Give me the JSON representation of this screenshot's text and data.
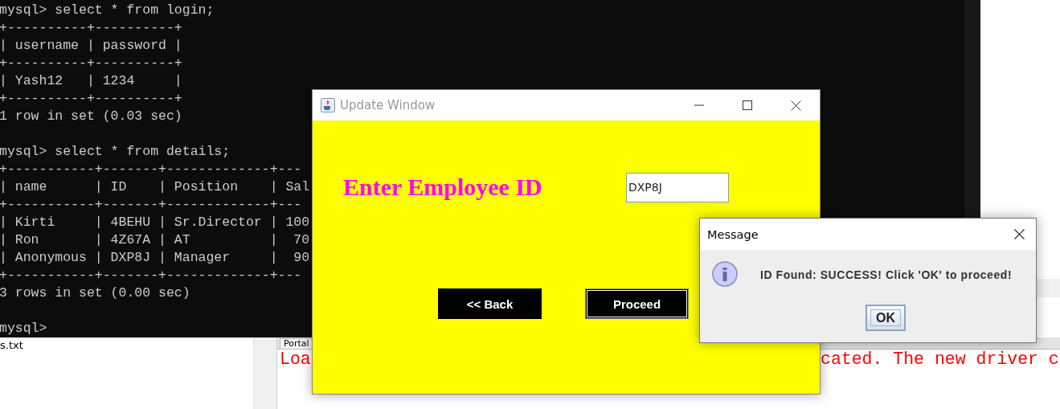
{
  "terminal": {
    "lines": [
      {
        "kind": "prompt",
        "text": "mysql> select * from login;"
      },
      {
        "kind": "table",
        "text": "+----------+----------+"
      },
      {
        "kind": "table",
        "text": "| username | password |"
      },
      {
        "kind": "table",
        "text": "+----------+----------+"
      },
      {
        "kind": "table",
        "text": "| Yash12   | 1234     |"
      },
      {
        "kind": "table",
        "text": "+----------+----------+"
      },
      {
        "kind": "result",
        "text": "1 row in set (0.03 sec)"
      },
      {
        "kind": "prompt",
        "text": "mysql> select * from details;"
      },
      {
        "kind": "table",
        "text": "+-----------+-------+-------------+---"
      },
      {
        "kind": "table",
        "text": "| name      | ID    | Position    | Sal"
      },
      {
        "kind": "table",
        "text": "+-----------+-------+-------------+---"
      },
      {
        "kind": "table",
        "text": "| Kirti     | 4BEHU | Sr.Director | 100"
      },
      {
        "kind": "table",
        "text": "| Ron       | 4Z67A | AT          |  70"
      },
      {
        "kind": "table",
        "text": "| Anonymous | DXP8J | Manager     |  90"
      },
      {
        "kind": "table",
        "text": "+-----------+-------+-------------+---"
      },
      {
        "kind": "result",
        "text": "3 rows in set (0.00 sec)"
      },
      {
        "kind": "prompt",
        "text": "mysql>"
      }
    ]
  },
  "explorer": {
    "file": "s.txt"
  },
  "editor": {
    "tab": "Portal",
    "console": [
      {
        "text": "Loa"
      },
      {
        "text": "cated. The new driver c"
      }
    ]
  },
  "update_window": {
    "title": "Update Window",
    "label": "Enter Employee ID",
    "field": {
      "value": "DXP8J"
    },
    "buttons": [
      {
        "label": "<< Back",
        "focused": false
      },
      {
        "label": "Proceed",
        "focused": true
      }
    ]
  },
  "message_dialog": {
    "title": "Message",
    "text": "ID Found: SUCCESS! Click 'OK' to proceed!",
    "button": "OK"
  }
}
